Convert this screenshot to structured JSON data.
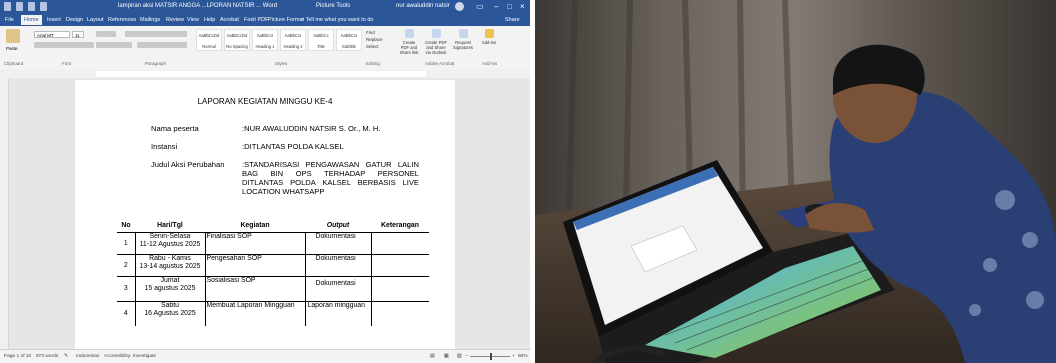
{
  "word": {
    "titlebar": {
      "document_title": "lampiran aksi MATSIR ANGGA ...LPORAN NATSIR ... Word",
      "center_label": "Picture Tools",
      "user_name": "nur awaluddin natsir"
    },
    "tabs": [
      "File",
      "Home",
      "Insert",
      "Design",
      "Layout",
      "References",
      "Mailings",
      "Review",
      "View",
      "Help",
      "Acrobat",
      "Foxit PDF",
      "Picture Format"
    ],
    "active_tab": "Home",
    "tell_me": "Tell me what you want to do",
    "share": "Share",
    "ribbon": {
      "paste": "Paste",
      "font_name": "Arial MT",
      "font_size": "11",
      "styles": [
        "Normal",
        "No Spacing",
        "Heading 1",
        "Heading 2",
        "Title",
        "Subtitle"
      ],
      "editing": [
        "Find",
        "Replace",
        "Select"
      ],
      "right_buttons": [
        "Create PDF and Share link",
        "Create PDF and Share via Outlook",
        "Request Signatures",
        "Add-ins"
      ],
      "groups": [
        "Clipboard",
        "Font",
        "Paragraph",
        "Styles",
        "Editing",
        "Adobe Acrobat",
        "Add-ins"
      ]
    },
    "document": {
      "title": "LAPORAN KEGIATAN MINGGU KE-4",
      "fields": [
        {
          "label": "Nama peserta",
          "value": ":NUR AWALUDDIN NATSIR S. Or., M. H."
        },
        {
          "label": "Instansi",
          "value": ":DITLANTAS POLDA KALSEL"
        },
        {
          "label": "Judul Aksi Perubahan",
          "value": ":STANDARISASI PENGAWASAN GATUR LALIN BAG BIN OPS TERHADAP PERSONEL DITLANTAS POLDA KALSEL BERBASIS LIVE LOCATION WHATSAPP"
        }
      ],
      "table": {
        "headers": [
          "No",
          "Hari/Tgl",
          "Kegiatan",
          "Output",
          "Keterangan"
        ],
        "rows": [
          {
            "no": "1",
            "day": "Senin-Selasa",
            "date": "11-12 Agustus 2025",
            "activity": "Finalisasi SOP",
            "output": "Dokumentasi",
            "note": ""
          },
          {
            "no": "2",
            "day": "Rabu - Kamis",
            "date": "13-14 agustus 2025",
            "activity": "Pengesahan SOP",
            "output": "Dokumentasi",
            "note": ""
          },
          {
            "no": "3",
            "day": "Jumat",
            "date": "15 agustus 2025",
            "activity": "Sosialisasi SOP",
            "output": "Dokumentasi",
            "note": ""
          },
          {
            "no": "4",
            "day": "Sabtu",
            "date": "16 Agustus 2025",
            "activity": "Membuat Laporan Mingguan",
            "output": "Laporan mingguan",
            "note": ""
          }
        ]
      }
    },
    "statusbar": {
      "page": "Page 1 of 10",
      "words": "873 words",
      "language": "Indonesian",
      "accessibility": "Accessibility: Investigate",
      "zoom": "90%"
    }
  },
  "photo": {
    "icon": "photo-laptop-user"
  }
}
